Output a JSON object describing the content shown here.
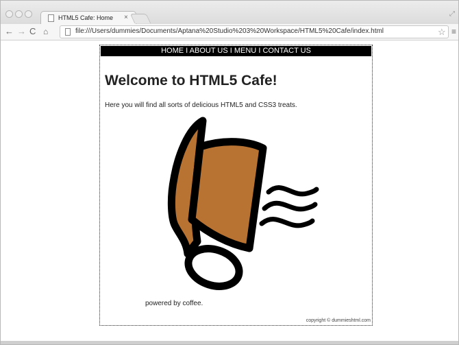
{
  "browser": {
    "tab_title": "HTML5 Cafe: Home",
    "tab_close": "×",
    "url": "file:///Users/dummies/Documents/Aptana%20Studio%203%20Workspace/HTML5%20Cafe/index.html",
    "back_glyph": "←",
    "forward_glyph": "→",
    "reload_glyph": "C",
    "home_glyph": "⌂",
    "star_glyph": "☆",
    "menu_glyph": "≡",
    "resize_glyph": "⤢"
  },
  "page": {
    "nav": {
      "items": [
        "HOME",
        "ABOUT US",
        "MENU",
        "CONTACT US"
      ],
      "separator": "I"
    },
    "heading": "Welcome to HTML5 Cafe!",
    "intro": "Here you will find all sorts of delicious HTML5 and CSS3 treats.",
    "footer_tagline": "powered by coffee.",
    "copyright": "copyright © dummieshtml.com",
    "illustration": {
      "name": "spilling-coffee-cup",
      "cup_color": "#b87333",
      "outline_color": "#000000"
    }
  }
}
